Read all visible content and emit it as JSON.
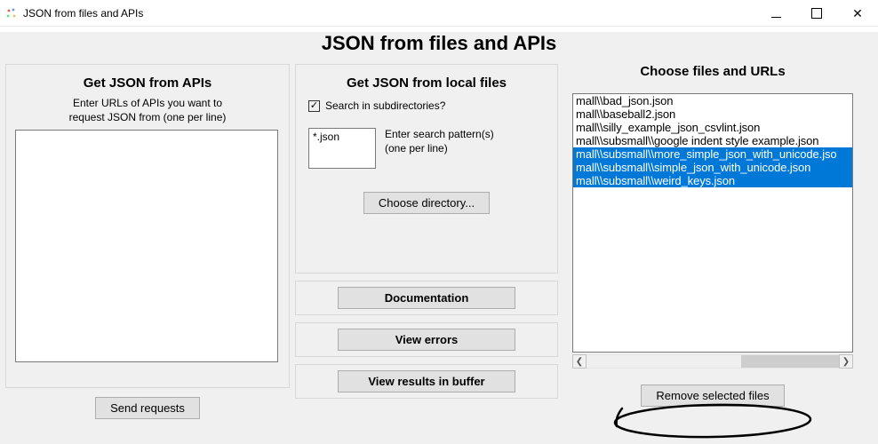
{
  "window": {
    "title": "JSON from files and APIs"
  },
  "main_heading": "JSON from files and APIs",
  "left": {
    "heading": "Get JSON from APIs",
    "help_line1": "Enter URLs of APIs you want to",
    "help_line2": "request JSON from (one per line)",
    "urls_value": "",
    "send_button": "Send requests"
  },
  "mid": {
    "heading": "Get JSON from local files",
    "search_subdirs_label": "Search in subdirectories?",
    "search_subdirs_checked": true,
    "pattern_value": "*.json",
    "pattern_help_line1": "Enter search pattern(s)",
    "pattern_help_line2": "(one per line)",
    "choose_dir_button": "Choose directory...",
    "documentation_button": "Documentation",
    "view_errors_button": "View errors",
    "view_results_button": "View results in buffer"
  },
  "right": {
    "heading": "Choose files and URLs",
    "files": [
      {
        "path": "mall\\\\bad_json.json",
        "selected": false
      },
      {
        "path": "mall\\\\baseball2.json",
        "selected": false
      },
      {
        "path": "mall\\\\silly_example_json_csvlint.json",
        "selected": false
      },
      {
        "path": "mall\\\\subsmall\\\\google indent style example.json",
        "selected": false
      },
      {
        "path": "mall\\\\subsmall\\\\more_simple_json_with_unicode.jso",
        "selected": true
      },
      {
        "path": "mall\\\\subsmall\\\\simple_json_with_unicode.json",
        "selected": true
      },
      {
        "path": "mall\\\\subsmall\\\\weird_keys.json",
        "selected": true
      }
    ],
    "remove_button": "Remove selected files"
  }
}
